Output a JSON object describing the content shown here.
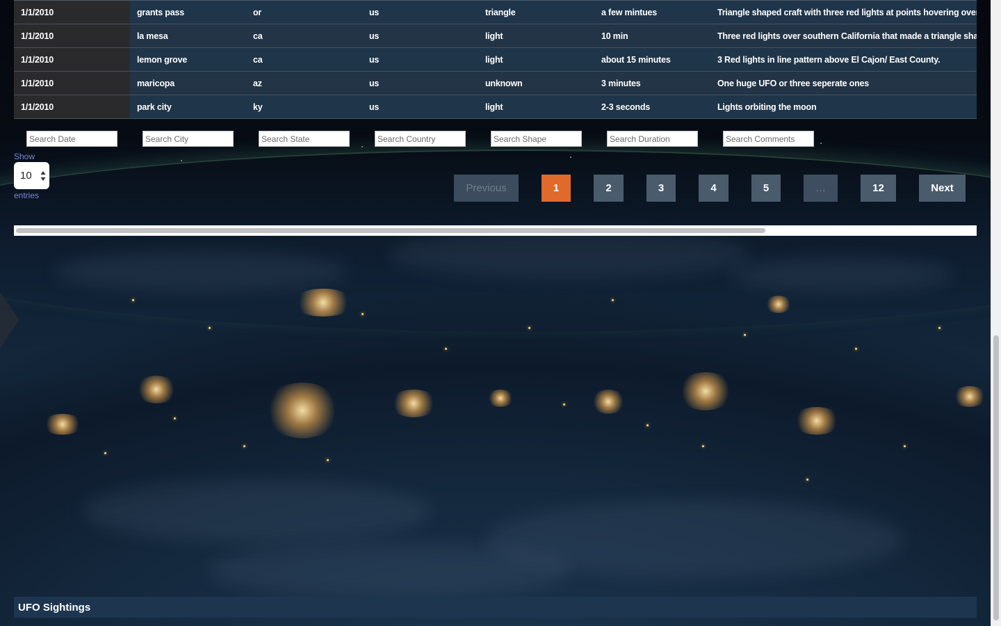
{
  "table": {
    "rows": [
      {
        "date": "1/1/2010",
        "city": "grants pass",
        "state": "or",
        "country": "us",
        "shape": "triangle",
        "duration": "a few mintues",
        "comments": "Triangle shaped craft with three red lights at points hovering over Gr"
      },
      {
        "date": "1/1/2010",
        "city": "la mesa",
        "state": "ca",
        "country": "us",
        "shape": "light",
        "duration": "10 min",
        "comments": "Three red lights over southern California that made a triangle shape"
      },
      {
        "date": "1/1/2010",
        "city": "lemon grove",
        "state": "ca",
        "country": "us",
        "shape": "light",
        "duration": "about 15 minutes",
        "comments": "3 Red lights in line pattern above El Cajon/ East County."
      },
      {
        "date": "1/1/2010",
        "city": "maricopa",
        "state": "az",
        "country": "us",
        "shape": "unknown",
        "duration": "3 minutes",
        "comments": "One huge UFO or three seperate ones"
      },
      {
        "date": "1/1/2010",
        "city": "park city",
        "state": "ky",
        "country": "us",
        "shape": "light",
        "duration": "2-3 seconds",
        "comments": "Lights orbiting the moon"
      }
    ]
  },
  "filters": {
    "date": "Search Date",
    "city": "Search City",
    "state": "Search State",
    "country": "Search Country",
    "shape": "Search Shape",
    "duration": "Search Duration",
    "comments": "Search Comments"
  },
  "length": {
    "show_label": "Show",
    "value": "10",
    "entries_label": "entries"
  },
  "pagination": {
    "previous": "Previous",
    "pages": [
      "1",
      "2",
      "3",
      "4",
      "5"
    ],
    "current": "1",
    "ellipsis": "…",
    "last": "12",
    "next": "Next"
  },
  "footer": {
    "title": "UFO Sightings"
  },
  "colors": {
    "accent": "#e06a2c",
    "pager_button": "#4a5b6c",
    "row_odd": "#1f3549",
    "row_even": "#223445",
    "footer_bg": "#1e3550",
    "label_text": "#7c86d6"
  }
}
